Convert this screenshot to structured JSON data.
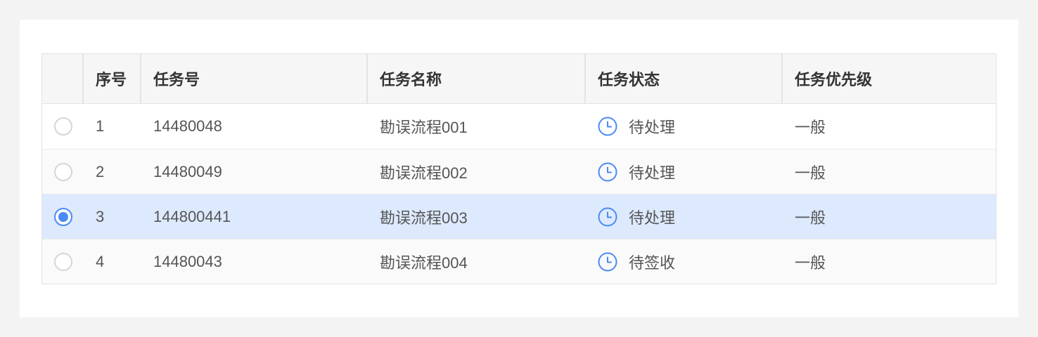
{
  "table": {
    "columns": [
      "",
      "序号",
      "任务号",
      "任务名称",
      "任务状态",
      "任务优先级"
    ],
    "rows": [
      {
        "index": "1",
        "task_no": "14480048",
        "task_name": "勘误流程001",
        "status": "待处理",
        "priority": "一般",
        "selected": false
      },
      {
        "index": "2",
        "task_no": "14480049",
        "task_name": "勘误流程002",
        "status": "待处理",
        "priority": "一般",
        "selected": false
      },
      {
        "index": "3",
        "task_no": "144800441",
        "task_name": "勘误流程003",
        "status": "待处理",
        "priority": "一般",
        "selected": true
      },
      {
        "index": "4",
        "task_no": "14480043",
        "task_name": "勘误流程004",
        "status": "待签收",
        "priority": "一般",
        "selected": false
      }
    ]
  },
  "icons": {
    "radio": "radio-icon",
    "status": "clock-icon"
  },
  "colors": {
    "accent": "#4a8af4",
    "selected_row": "#dde9fd",
    "header_bg": "#f6f6f6",
    "page_bg": "#f3f3f3"
  }
}
